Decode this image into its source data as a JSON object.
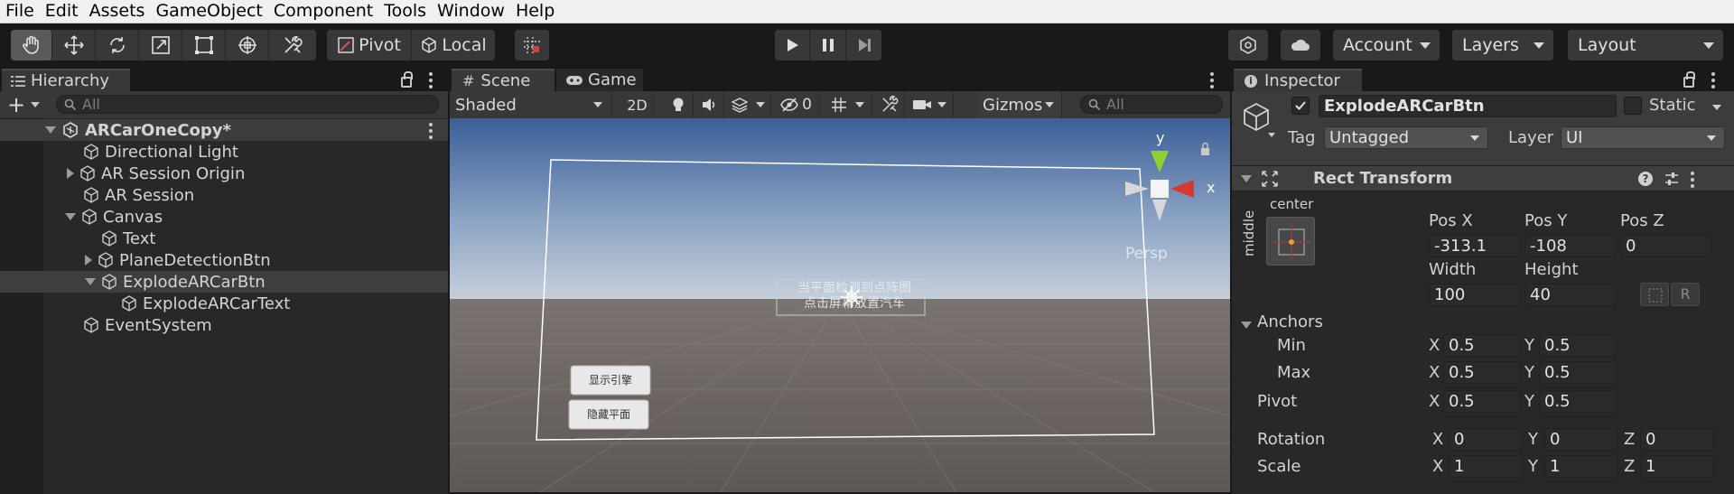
{
  "menu": [
    "File",
    "Edit",
    "Assets",
    "GameObject",
    "Component",
    "Tools",
    "Window",
    "Help"
  ],
  "toolbar": {
    "pivot_label": "Pivot",
    "local_label": "Local",
    "account_label": "Account",
    "layers_label": "Layers",
    "layout_label": "Layout"
  },
  "hierarchy": {
    "tab_label": "Hierarchy",
    "search_placeholder": "All",
    "scene_name": "ARCarOneCopy*",
    "items": [
      {
        "label": "Directional Light"
      },
      {
        "label": "AR Session Origin"
      },
      {
        "label": "AR Session"
      },
      {
        "label": "Canvas"
      },
      {
        "label": "Text"
      },
      {
        "label": "PlaneDetectionBtn"
      },
      {
        "label": "ExplodeARCarBtn"
      },
      {
        "label": "ExplodeARCarText"
      },
      {
        "label": "EventSystem"
      }
    ]
  },
  "scene": {
    "tab_scene": "Scene",
    "tab_game": "Game",
    "shading_mode": "Shaded",
    "mode_2d": "2D",
    "hidden_count": "0",
    "gizmos_label": "Gizmos",
    "search_placeholder": "All",
    "axis_y": "y",
    "axis_x": "x",
    "persp_label": "Persp",
    "canvas_text_line1": "当平面检测到点阵图",
    "canvas_text_line2": "点击屏幕放置汽车",
    "button_show_engine": "显示引擎",
    "button_hide_plane": "隐藏平面"
  },
  "inspector": {
    "tab_label": "Inspector",
    "object_name": "ExplodeARCarBtn",
    "static_label": "Static",
    "tag_label": "Tag",
    "tag_value": "Untagged",
    "layer_label": "Layer",
    "layer_value": "UI",
    "component_title": "Rect Transform",
    "anchor_preset_top": "center",
    "anchor_preset_side": "middle",
    "pos_x_label": "Pos X",
    "pos_y_label": "Pos Y",
    "pos_z_label": "Pos Z",
    "pos_x": "-313.1",
    "pos_y": "-108",
    "pos_z": "0",
    "width_label": "Width",
    "height_label": "Height",
    "width": "100",
    "height": "40",
    "r_button": "R",
    "anchors_label": "Anchors",
    "min_label": "Min",
    "max_label": "Max",
    "pivot_label": "Pivot",
    "rotation_label": "Rotation",
    "scale_label": "Scale",
    "x": "X",
    "y": "Y",
    "z": "Z",
    "anchor_min_x": "0.5",
    "anchor_min_y": "0.5",
    "anchor_max_x": "0.5",
    "anchor_max_y": "0.5",
    "pivot_x": "0.5",
    "pivot_y": "0.5",
    "rotation_x": "0",
    "rotation_y": "0",
    "rotation_z": "0",
    "scale_x": "1",
    "scale_y": "1",
    "scale_z": "1"
  },
  "colors": {
    "gizmo_x": "#d63a2f",
    "gizmo_y": "#8fd12e",
    "selection_bg": "#3e3e3e",
    "anchor_dot": "#f0a030"
  }
}
